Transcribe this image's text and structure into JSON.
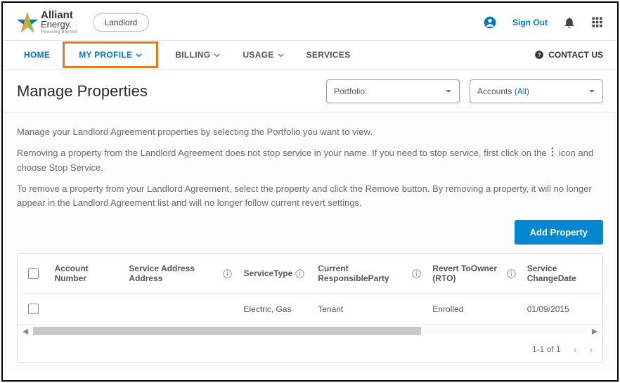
{
  "brand": {
    "name": "Alliant",
    "sub": "Energy.",
    "tagline": "Powering Beyond"
  },
  "userChip": "Landlord",
  "header": {
    "signOut": "Sign Out"
  },
  "nav": {
    "home": "HOME",
    "myProfile": "MY PROFILE",
    "billing": "BILLING",
    "usage": "USAGE",
    "services": "SERVICES",
    "contact": "CONTACT US"
  },
  "page": {
    "title": "Manage Properties",
    "portfolioLabel": "Portfolio:",
    "accountsLabel": "Accounts",
    "accountsFilter": "(All)"
  },
  "intro": {
    "p1": "Manage your Landlord Agreement properties by selecting the Portfolio you want to view.",
    "p2a": "Removing a property from the Landlord Agreement does not stop service in your name. If you need to stop service, first click on the",
    "p2b": "icon and choose Stop Service.",
    "p3": "To remove a property from your Landlord Agreement, select the property and click the Remove button. By removing a property, it will no longer appear in the Landlord Agreement list and will no longer follow current revert settings."
  },
  "buttons": {
    "addProperty": "Add Property"
  },
  "table": {
    "headers": {
      "account": "Account Number",
      "address": "Service Address Address",
      "serviceType": "ServiceType",
      "responsible": "Current ResponsibleParty",
      "rto": "Revert ToOwner (RTO)",
      "changeDate": "Service ChangeDate"
    },
    "rows": [
      {
        "account": "",
        "address": "",
        "serviceType": "Electric, Gas",
        "responsible": "Tenant",
        "rto": "Enrolled",
        "changeDate": "01/09/2015"
      }
    ],
    "pager": "1-1 of 1"
  }
}
